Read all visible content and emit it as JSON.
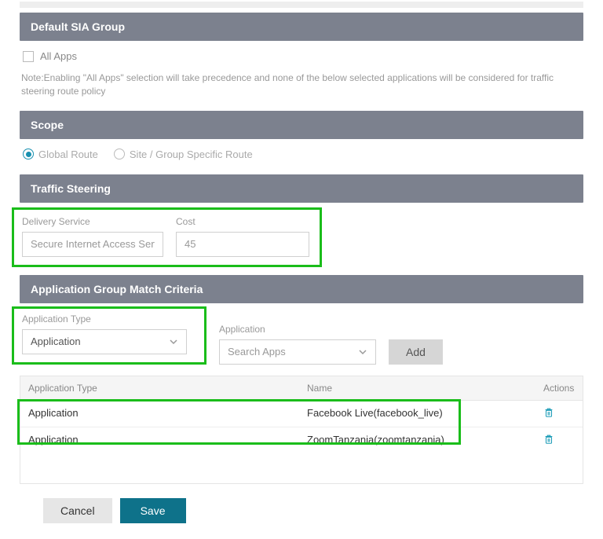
{
  "sections": {
    "sia_group": "Default SIA Group",
    "scope": "Scope",
    "traffic_steering": "Traffic Steering",
    "match_criteria": "Application Group Match Criteria"
  },
  "all_apps": {
    "label": "All Apps",
    "note": "Note:Enabling \"All Apps\" selection will take precedence and none of the below selected applications will be considered for traffic steering route policy"
  },
  "scope_options": {
    "global": "Global Route",
    "site": "Site / Group Specific Route"
  },
  "delivery": {
    "service_label": "Delivery Service",
    "service_value": "Secure Internet Access Serv",
    "cost_label": "Cost",
    "cost_value": "45"
  },
  "criteria": {
    "app_type_label": "Application Type",
    "app_type_value": "Application",
    "application_label": "Application",
    "search_placeholder": "Search Apps",
    "add_label": "Add"
  },
  "table": {
    "headers": {
      "type": "Application Type",
      "name": "Name",
      "actions": "Actions"
    },
    "rows": [
      {
        "type": "Application",
        "name": "Facebook Live(facebook_live)"
      },
      {
        "type": "Application",
        "name": "ZoomTanzania(zoomtanzania)"
      }
    ]
  },
  "buttons": {
    "cancel": "Cancel",
    "save": "Save"
  }
}
